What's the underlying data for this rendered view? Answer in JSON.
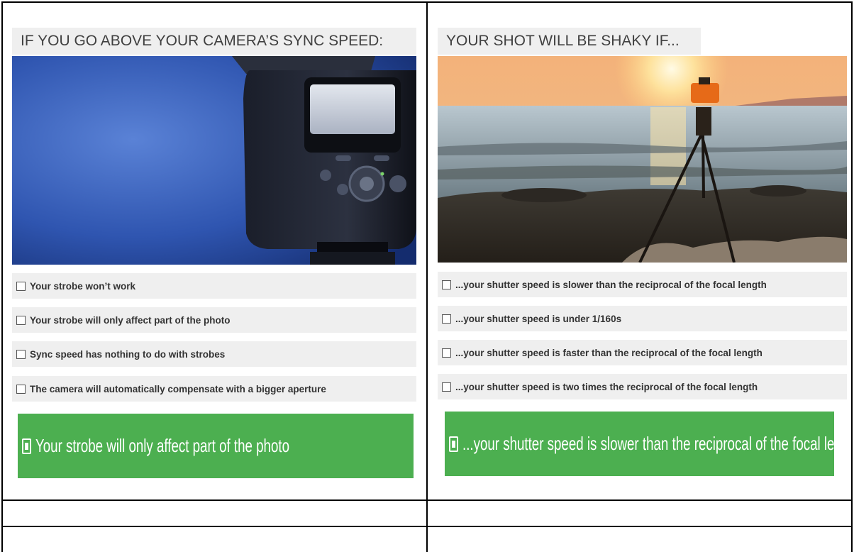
{
  "left": {
    "title": "IF YOU GO ABOVE YOUR CAMERA’S SYNC SPEED:",
    "image": "camera-flash-photo",
    "options": [
      "Your strobe won’t work",
      "Your strobe will only affect part of the photo",
      "Sync speed has nothing to do with strobes",
      "The camera will automatically compensate with a bigger aperture"
    ],
    "answer": "Your strobe will only affect part of the photo"
  },
  "right": {
    "title": "YOUR SHOT WILL BE SHAKY IF...",
    "image": "tripod-sunset-beach-photo",
    "options": [
      "...your shutter speed is slower than the reciprocal of the focal length",
      "...your shutter speed is under 1/160s",
      "...your shutter speed is faster than the reciprocal of the focal length",
      "...your shutter speed is two times the reciprocal of the focal length"
    ],
    "answer": "...your shutter speed is slower than the reciprocal of the focal length"
  },
  "colors": {
    "answer_bg": "#4caf50",
    "option_bg": "#efefef",
    "border": "#000000"
  },
  "icons": [
    "checkbox-icon",
    "answer-check-icon"
  ]
}
